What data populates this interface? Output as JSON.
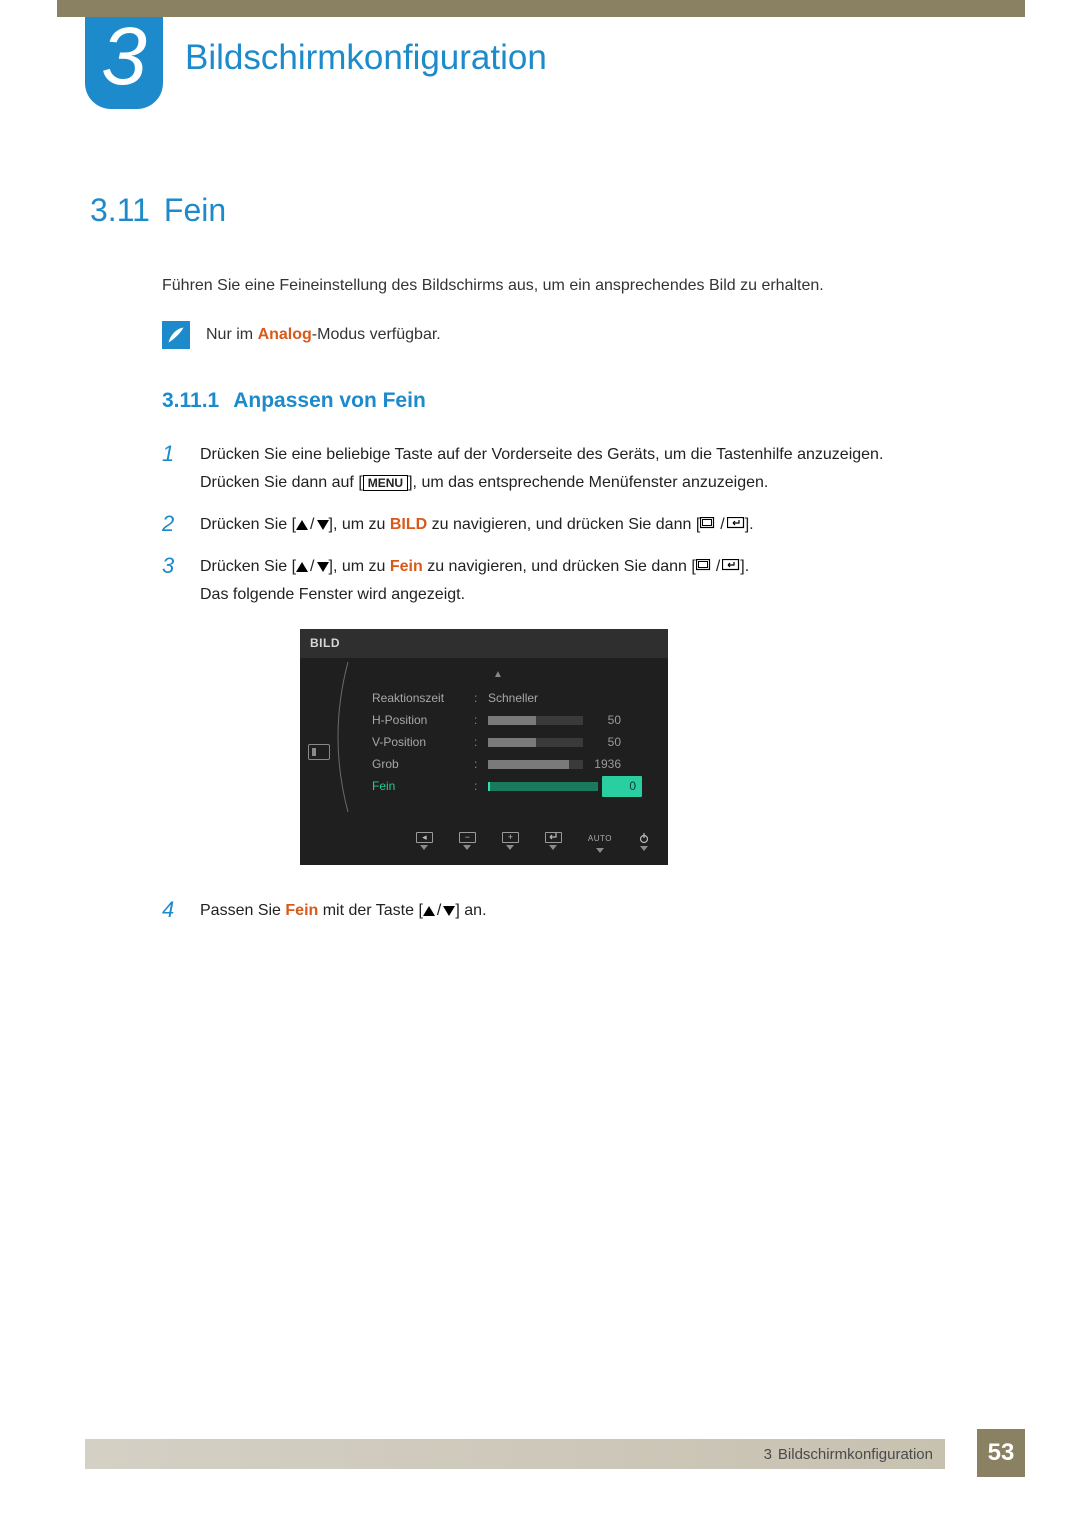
{
  "chapter": {
    "number": "3",
    "title": "Bildschirmkonfiguration"
  },
  "section": {
    "number": "3.11",
    "title": "Fein",
    "intro": "Führen Sie eine Feineinstellung des Bildschirms aus, um ein ansprechendes Bild zu erhalten.",
    "note_pre": "Nur im ",
    "note_highlight": "Analog",
    "note_post": "-Modus verfügbar."
  },
  "subsection": {
    "number": "3.11.1",
    "title": "Anpassen von Fein"
  },
  "steps": {
    "s1": {
      "num": "1",
      "l1": "Drücken Sie eine beliebige Taste auf der Vorderseite des Geräts, um die Tastenhilfe anzuzeigen.",
      "l2a": "Drücken Sie dann auf [",
      "menu": "MENU",
      "l2b": "], um das entsprechende Menüfenster anzuzeigen."
    },
    "s2": {
      "num": "2",
      "a": "Drücken Sie [",
      "b": "], um zu ",
      "hl": "BILD",
      "c": " zu navigieren, und drücken Sie dann [",
      "d": "]."
    },
    "s3": {
      "num": "3",
      "a": "Drücken Sie [",
      "b": "], um zu ",
      "hl": "Fein",
      "c": " zu navigieren, und drücken Sie dann [",
      "d": "].",
      "after": "Das folgende Fenster wird angezeigt."
    },
    "s4": {
      "num": "4",
      "a": "Passen Sie ",
      "hl": "Fein",
      "b": " mit der Taste [",
      "c": "] an."
    }
  },
  "osd": {
    "title": "BILD",
    "rows": {
      "r1": {
        "label": "Reaktionszeit",
        "value": "Schneller"
      },
      "r2": {
        "label": "H-Position",
        "value": "50",
        "fill": 50
      },
      "r3": {
        "label": "V-Position",
        "value": "50",
        "fill": 50
      },
      "r4": {
        "label": "Grob",
        "value": "1936",
        "fill": 85
      },
      "r5": {
        "label": "Fein",
        "value": "0",
        "fill": 2
      }
    },
    "footer": {
      "auto": "AUTO"
    }
  },
  "footer": {
    "chapnum": "3",
    "chaptitle": "Bildschirmkonfiguration",
    "page": "53"
  }
}
